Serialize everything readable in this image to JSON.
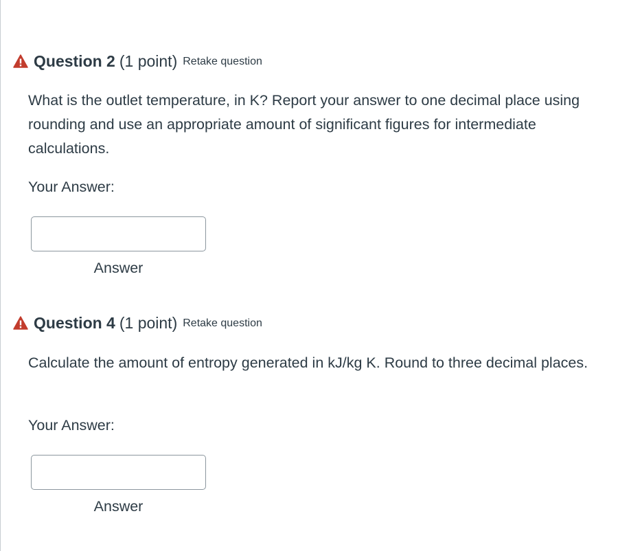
{
  "questions": [
    {
      "title": "Question 2",
      "points": "(1 point)",
      "retake": "Retake question",
      "text": "What is the outlet temperature, in K? Report your answer to one decimal place using rounding and use an appropriate amount of significant figures for intermediate calculations.",
      "answer_label": "Your Answer:",
      "input_value": "",
      "answer_caption": "Answer",
      "icon": "warning-triangle-icon"
    },
    {
      "title": "Question 4",
      "points": "(1 point)",
      "retake": "Retake question",
      "text": "Calculate the amount of entropy generated in kJ/kg K. Round to three decimal places.",
      "answer_label": "Your Answer:",
      "input_value": "",
      "answer_caption": "Answer",
      "icon": "warning-triangle-icon"
    }
  ],
  "colors": {
    "text": "#2d3b45",
    "warning": "#c23c2d",
    "input_border": "#8b969e",
    "page_border": "#c7cdd1"
  }
}
